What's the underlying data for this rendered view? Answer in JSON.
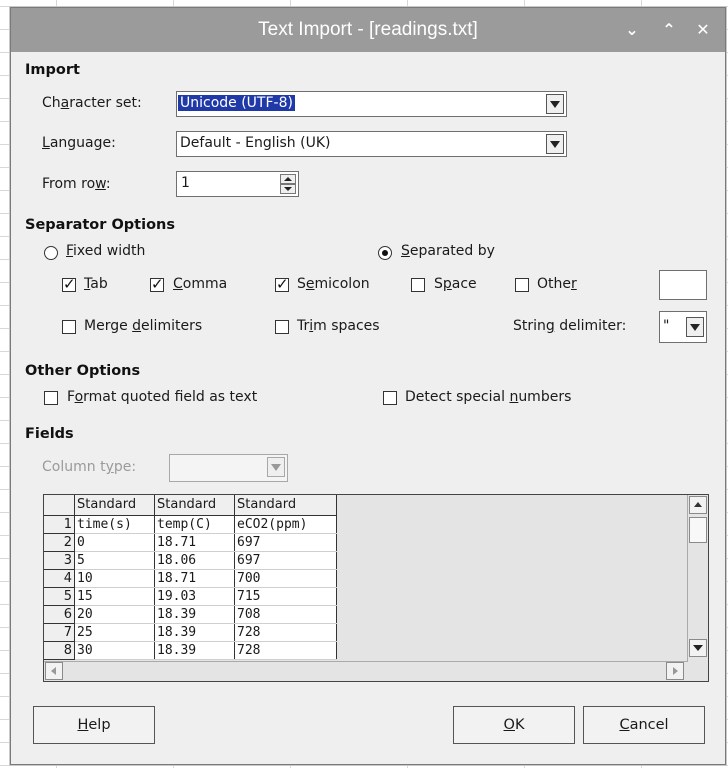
{
  "window": {
    "title": "Text Import - [readings.txt]"
  },
  "titlebar_icons": [
    "chevron-down-icon",
    "chevron-up-icon",
    "close-icon"
  ],
  "titlebar_glyphs": {
    "minimize": "⌄",
    "maximize": "⌃",
    "close": "✕"
  },
  "import": {
    "section_title": "Import",
    "charset_label_pre": "Ch",
    "charset_label_u": "a",
    "charset_label_post": "racter set:",
    "charset_value": "Unicode (UTF-8)",
    "language_label_u": "L",
    "language_label_post": "anguage:",
    "language_value": "Default - English (UK)",
    "from_row_label_pre": "From ro",
    "from_row_label_u": "w",
    "from_row_label_post": ":",
    "from_row_value": "1"
  },
  "separator": {
    "section_title": "Separator Options",
    "fixed_width_u": "F",
    "fixed_width_post": "ixed width",
    "fixed_width_selected": false,
    "separated_by_u": "S",
    "separated_by_post": "eparated by",
    "separated_by_selected": true,
    "tab_u": "T",
    "tab_post": "ab",
    "tab_checked": true,
    "comma_u": "C",
    "comma_post": "omma",
    "comma_checked": true,
    "semicolon_pre": "S",
    "semicolon_u": "e",
    "semicolon_post": "micolon",
    "semicolon_checked": true,
    "space_pre": "S",
    "space_u": "p",
    "space_post": "ace",
    "space_checked": false,
    "other_pre": "Othe",
    "other_u": "r",
    "other_checked": false,
    "other_value": "",
    "merge_pre": "Merge ",
    "merge_u": "d",
    "merge_post": "elimiters",
    "merge_checked": false,
    "trim_pre": "Tr",
    "trim_u": "i",
    "trim_post": "m spaces",
    "trim_checked": false,
    "string_delim_pre": "Strin",
    "string_delim_u": "g",
    "string_delim_post": " delimiter:",
    "string_delim_value": "\""
  },
  "other": {
    "section_title": "Other Options",
    "format_quoted_pre": "F",
    "format_quoted_u": "o",
    "format_quoted_post": "rmat quoted field as text",
    "format_quoted_checked": false,
    "detect_pre": "Detect special ",
    "detect_u": "n",
    "detect_post": "umbers",
    "detect_checked": false
  },
  "fields": {
    "section_title": "Fields",
    "column_type_pre": "Column t",
    "column_type_u": "y",
    "column_type_post": "pe:",
    "column_type_value": ""
  },
  "preview": {
    "headers": [
      "Standard",
      "Standard",
      "Standard"
    ],
    "rows": [
      [
        "1",
        "time(s)",
        "temp(C)",
        "eCO2(ppm)"
      ],
      [
        "2",
        "0",
        "18.71",
        "697"
      ],
      [
        "3",
        "5",
        "18.06",
        "697"
      ],
      [
        "4",
        "10",
        "18.71",
        "700"
      ],
      [
        "5",
        "15",
        "19.03",
        "715"
      ],
      [
        "6",
        "20",
        "18.39",
        "708"
      ],
      [
        "7",
        "25",
        "18.39",
        "728"
      ],
      [
        "8",
        "30",
        "18.39",
        "728"
      ]
    ]
  },
  "buttons": {
    "help_u": "H",
    "help_post": "elp",
    "ok_u": "O",
    "ok_post": "K",
    "cancel_u": "C",
    "cancel_post": "ancel"
  }
}
